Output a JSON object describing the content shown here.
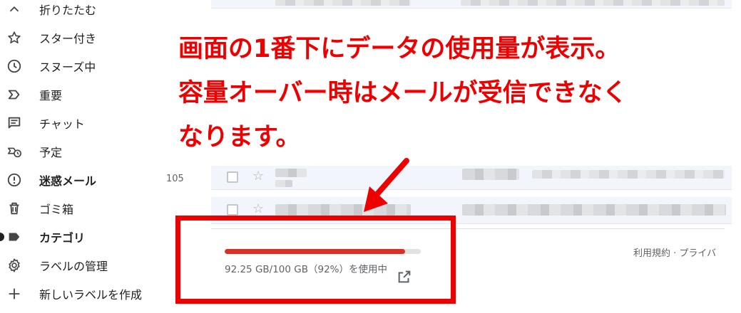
{
  "sidebar": {
    "items": [
      {
        "icon": "chevron-up-icon",
        "label": "折りたたむ",
        "bold": false
      },
      {
        "icon": "star-icon",
        "label": "スター付き",
        "bold": false
      },
      {
        "icon": "clock-icon",
        "label": "スヌーズ中",
        "bold": false
      },
      {
        "icon": "label-important-icon",
        "label": "重要",
        "bold": false
      },
      {
        "icon": "chat-icon",
        "label": "チャット",
        "bold": false
      },
      {
        "icon": "scheduled-icon",
        "label": "予定",
        "bold": false
      },
      {
        "icon": "spam-icon",
        "label": "迷惑メール",
        "bold": true
      },
      {
        "icon": "trash-icon",
        "label": "ゴミ箱",
        "bold": false
      },
      {
        "icon": "label-icon",
        "label": "カテゴリ",
        "bold": true
      },
      {
        "icon": "gear-icon",
        "label": "ラベルの管理",
        "bold": false
      },
      {
        "icon": "plus-icon",
        "label": "新しいラベルを作成",
        "bold": false
      }
    ],
    "spam_count": "105"
  },
  "storage": {
    "usage_text": "92.25 GB/100 GB（92%）を使用中",
    "used_fraction": 0.92,
    "bar_color": "#d93025"
  },
  "footer": {
    "links": "利用規約 · プライバ"
  },
  "annotation": {
    "lines": [
      "画面の1番下にデータの使用量が表示。",
      "容量オーバー時はメールが受信できなく",
      "なります。"
    ],
    "color": "#ee0000"
  }
}
